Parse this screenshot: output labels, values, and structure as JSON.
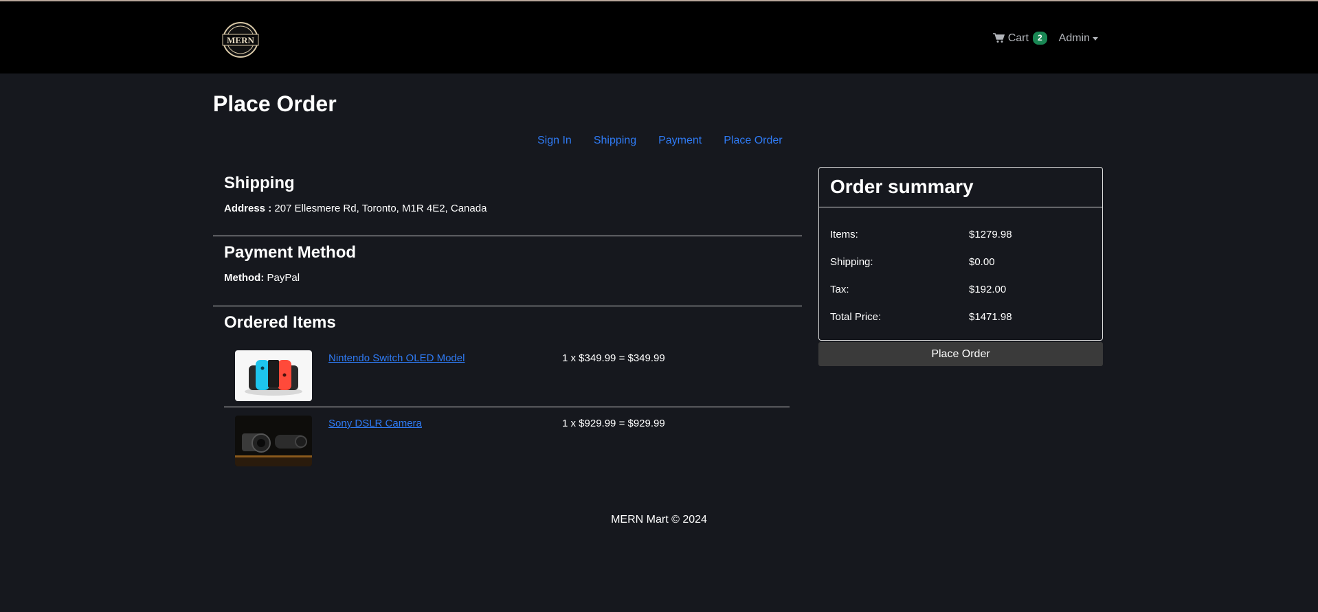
{
  "header": {
    "logo_text": "MERN",
    "cart_label": "Cart",
    "cart_count": "2",
    "user_label": "Admin"
  },
  "page": {
    "title": "Place Order"
  },
  "steps": [
    "Sign In",
    "Shipping",
    "Payment",
    "Place Order"
  ],
  "shipping": {
    "heading": "Shipping",
    "address_label": "Address :",
    "address": "207 Ellesmere Rd, Toronto, M1R 4E2, Canada"
  },
  "payment": {
    "heading": "Payment Method",
    "method_label": "Method:",
    "method": "PayPal"
  },
  "ordered": {
    "heading": "Ordered Items",
    "items": [
      {
        "name": "Nintendo Switch OLED Model",
        "price_line": "1 x $349.99 = $349.99"
      },
      {
        "name": "Sony DSLR Camera",
        "price_line": "1 x $929.99 = $929.99"
      }
    ]
  },
  "summary": {
    "heading": "Order summary",
    "rows": [
      {
        "label": "Items:",
        "value": "$1279.98"
      },
      {
        "label": "Shipping:",
        "value": "$0.00"
      },
      {
        "label": "Tax:",
        "value": "$192.00"
      },
      {
        "label": "Total Price:",
        "value": "$1471.98"
      }
    ],
    "button_label": "Place Order"
  },
  "footer": {
    "text": "MERN Mart © 2024"
  },
  "colors": {
    "accent": "#2f7bf5",
    "badge": "#198754",
    "background": "#16181e",
    "navbar": "#000000"
  }
}
